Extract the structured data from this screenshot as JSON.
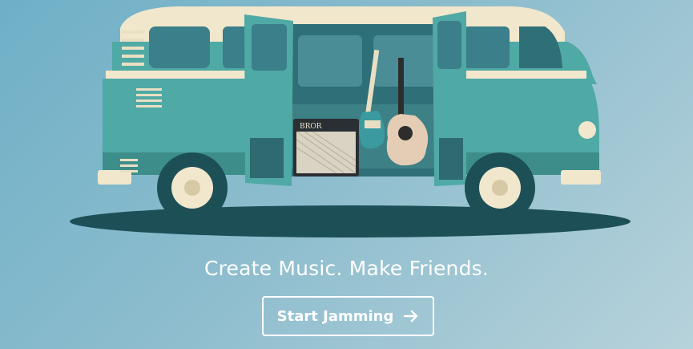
{
  "hero": {
    "tagline": "Create Music. Make Friends.",
    "cta_label": "Start Jamming",
    "cta_icon": "arrow-right-icon",
    "amp_brand": "BROR"
  },
  "colors": {
    "bus_body": "#4fa9a5",
    "bus_roof": "#f1e7cc",
    "shadow": "#1d4f57",
    "text": "#ffffff"
  }
}
